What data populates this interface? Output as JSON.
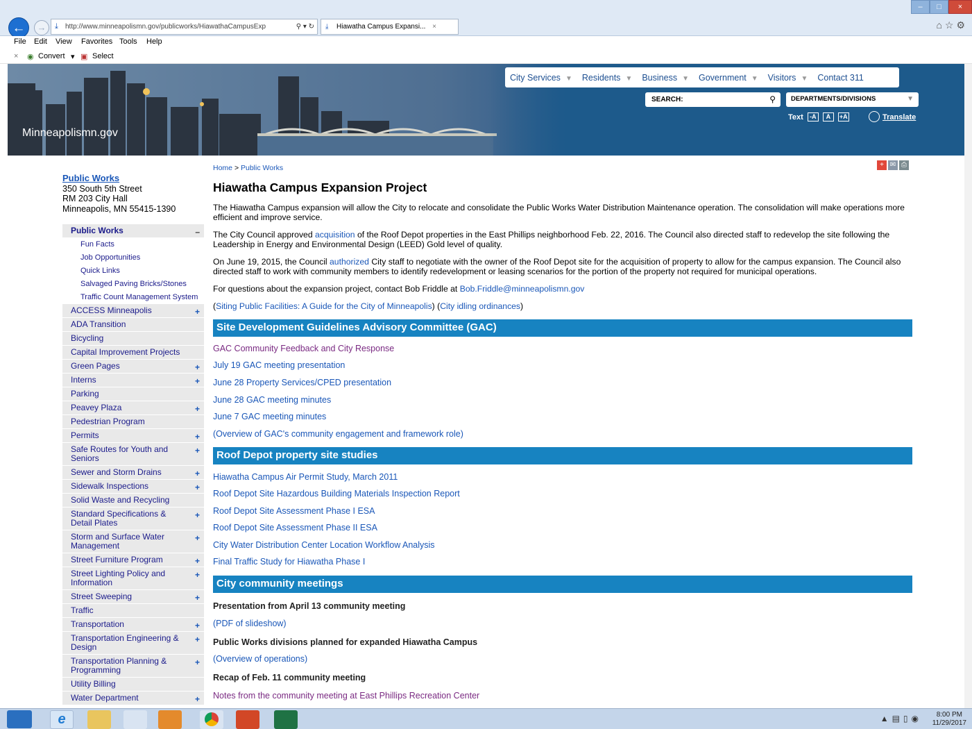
{
  "browser": {
    "url": "http://www.minneapolismn.gov/publicworks/HiawathaCampusExp",
    "tab_title": "Hiawatha Campus Expansi...",
    "menus": [
      "File",
      "Edit",
      "View",
      "Favorites",
      "Tools",
      "Help"
    ],
    "convert": "Convert",
    "select": "Select"
  },
  "header": {
    "site_name": "Minneapolismn.gov",
    "nav": [
      "City Services",
      "Residents",
      "Business",
      "Government",
      "Visitors",
      "Contact 311"
    ],
    "search_label": "SEARCH:",
    "dept_label": "DEPARTMENTS/DIVISIONS",
    "text_label": "Text",
    "text_sizes": [
      "-A",
      "A",
      "+A"
    ],
    "translate": "Translate"
  },
  "sidebar": {
    "title": "Public Works",
    "address": [
      "350 South 5th Street",
      "RM 203 City Hall",
      "Minneapolis, MN  55415-1390"
    ],
    "active_section": "Public Works",
    "sub_items": [
      "Fun Facts",
      "Job Opportunities",
      "Quick Links",
      "Salvaged Paving Bricks/Stones",
      "Traffic Count Management System"
    ],
    "sections": [
      {
        "label": "ACCESS Minneapolis",
        "plus": "+"
      },
      {
        "label": "ADA Transition",
        "plus": ""
      },
      {
        "label": "Bicycling",
        "plus": ""
      },
      {
        "label": "Capital Improvement Projects",
        "plus": ""
      },
      {
        "label": "Green Pages",
        "plus": "+"
      },
      {
        "label": "Interns",
        "plus": "+"
      },
      {
        "label": "Parking",
        "plus": ""
      },
      {
        "label": "Peavey Plaza",
        "plus": "+"
      },
      {
        "label": "Pedestrian Program",
        "plus": ""
      },
      {
        "label": "Permits",
        "plus": "+"
      },
      {
        "label": "Safe Routes for Youth and Seniors",
        "plus": "+"
      },
      {
        "label": "Sewer and Storm Drains",
        "plus": "+"
      },
      {
        "label": "Sidewalk Inspections",
        "plus": "+"
      },
      {
        "label": "Solid Waste and Recycling",
        "plus": ""
      },
      {
        "label": "Standard Specifications & Detail Plates",
        "plus": "+"
      },
      {
        "label": "Storm and Surface Water Management",
        "plus": "+"
      },
      {
        "label": "Street Furniture Program",
        "plus": "+"
      },
      {
        "label": "Street Lighting Policy and Information",
        "plus": "+"
      },
      {
        "label": "Street Sweeping",
        "plus": "+"
      },
      {
        "label": "Traffic",
        "plus": ""
      },
      {
        "label": "Transportation",
        "plus": "+"
      },
      {
        "label": "Transportation Engineering & Design",
        "plus": "+"
      },
      {
        "label": "Transportation Planning & Programming",
        "plus": "+"
      },
      {
        "label": "Utility Billing",
        "plus": ""
      },
      {
        "label": "Water Department",
        "plus": "+"
      }
    ]
  },
  "main": {
    "breadcrumb_home": "Home",
    "breadcrumb_sep": ">",
    "breadcrumb_section": "Public Works",
    "title": "Hiawatha Campus Expansion Project",
    "intro": "The Hiawatha Campus expansion will allow the City to relocate and consolidate the Public Works Water Distribution Maintenance operation. The consolidation will make operations more efficient and improve service.",
    "p2_a": "The City Council approved ",
    "p2_link": "acquisition",
    "p2_b": " of the Roof Depot properties in the East Phillips neighborhood Feb. 22, 2016. The Council also directed staff to redevelop the site following the Leadership in Energy and Environmental Design (LEED) Gold level of quality.",
    "p3_a": "On June 19, 2015, the Council ",
    "p3_link": "authorized ",
    "p3_b": "City staff to negotiate with the owner of the Roof Depot site for the acquisition of property to allow for the campus expansion. The Council also directed staff to work with community members to identify redevelopment or leasing scenarios for the portion of the property not required for municipal operations.",
    "p4_a": "For questions about the expansion project, contact Bob Friddle at ",
    "p4_email": "Bob.Friddle@minneapolismn.gov",
    "p5_link1": "Siting Public Facilities: A Guide for the City of Minneapolis",
    "p5_link2": "City idling ordinances",
    "section1": "Site Development Guidelines Advisory Committee (GAC)",
    "s1_links": [
      "GAC Community Feedback and City Response",
      "July 19 GAC meeting presentation",
      "June 28 Property Services/CPED presentation",
      "June 28 GAC meeting minutes",
      "June 7 GAC meeting minutes",
      "(Overview of GAC's community engagement and framework role)"
    ],
    "section2": "Roof Depot property site studies",
    "s2_links": [
      "Hiawatha Campus Air Permit Study, March 2011",
      "Roof Depot Site Hazardous Building Materials Inspection Report",
      "Roof Depot Site Assessment Phase I ESA",
      "Roof Depot Site Assessment Phase II ESA",
      "City Water Distribution Center Location Workflow Analysis",
      "Final Traffic Study for Hiawatha Phase I"
    ],
    "section3": "City community meetings",
    "m1_title": "Presentation from April 13 community meeting",
    "m1_link": "(PDF of slideshow)",
    "m2_title": "Public Works divisions planned for expanded Hiawatha Campus",
    "m2_link": "(Overview of operations)",
    "m3_title": "Recap of Feb. 11 community meeting",
    "m3_link": "Notes from the community meeting at East Phillips Recreation Center"
  },
  "taskbar": {
    "time": "8:00 PM",
    "date": "11/29/2017"
  }
}
